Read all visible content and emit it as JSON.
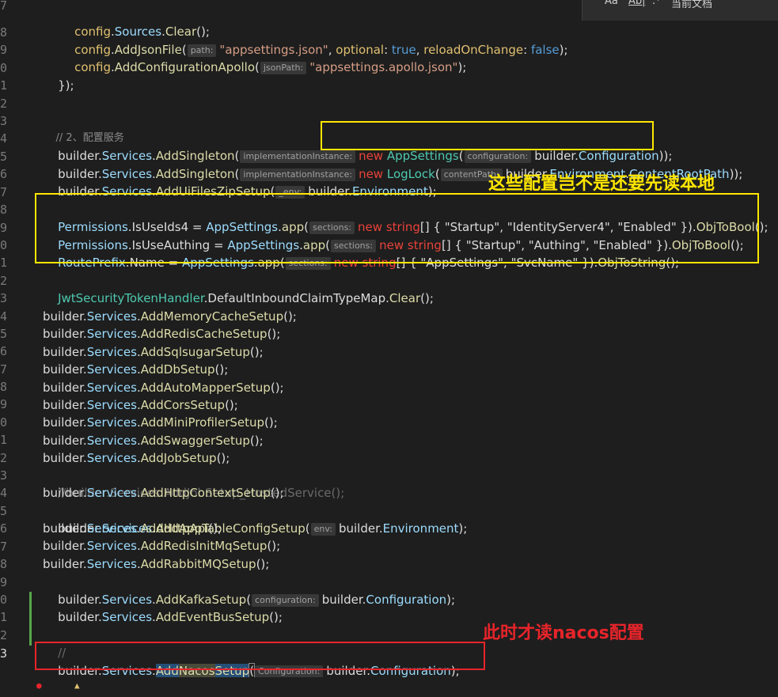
{
  "toolbar": {
    "match_case_label": "Aa",
    "match_word_label": "Ab|",
    "regex_label": ".*",
    "scope_label": "当前文档"
  },
  "line_numbers": [
    "7",
    "8",
    "9",
    "0",
    "1",
    "2",
    "3",
    "4",
    "5",
    "6",
    "7",
    "8",
    "9",
    "0",
    "1",
    "2",
    "3",
    "4",
    "5",
    "6",
    "7",
    "8",
    "9",
    "0",
    "1",
    "2",
    "3",
    "4",
    "5",
    "6",
    "7",
    "8",
    "9",
    "0",
    "1",
    "2",
    "3"
  ],
  "active_line_number": "3",
  "code": {
    "l_sources_clear": {
      "obj": "config",
      "prop": "Sources",
      "method": "Clear",
      "tail": "();"
    },
    "l_add_json": {
      "obj": "config",
      "method": "AddJsonFile",
      "hint": "path:",
      "arg": "\"appsettings.json\"",
      "p2": "optional",
      "v2": "true",
      "p3": "reloadOnChange",
      "v3": "false",
      "tail": ");"
    },
    "l_add_apollo": {
      "obj": "config",
      "method": "AddConfigurationApollo",
      "hint": "jsonPath:",
      "arg": "\"appsettings.apollo.json\"",
      "tail": ");"
    },
    "l_close": "});",
    "l_comment": "// 2、配置服务",
    "l_singleton1": {
      "obj": "builder",
      "svc": "Services",
      "method": "AddSingleton",
      "hint": "implementationInstance:",
      "kw": "new",
      "cls": "AppSettings",
      "hint2": "configuration:",
      "arg": "builder",
      "argprop": "Configuration",
      "tail": "));"
    },
    "l_singleton2": {
      "obj": "builder",
      "svc": "Services",
      "method": "AddSingleton",
      "hint": "implementationInstance:",
      "kw": "new",
      "cls": "LogLock",
      "hint2": "contentPath:",
      "arg": "builder",
      "argprop": "Environment",
      "argprop2": "ContentRootPath",
      "tail": "));"
    },
    "l_uizip": {
      "obj": "builder",
      "svc": "Services",
      "method": "AddUiFilesZipSetup",
      "hint": "_env:",
      "arg": "builder",
      "argprop": "Environment",
      "tail": ");"
    },
    "l_perm1": {
      "cls": "Permissions",
      "prop": "IsUseIds4",
      "eq": " = ",
      "cls2": "AppSettings",
      "method": "app",
      "hint": "sections:",
      "kw": "new",
      "type": "string",
      "brk": "[] { ",
      "s1": "\"Startup\"",
      "s2": "\"IdentityServer4\"",
      "s3": "\"Enabled\"",
      "close": " })",
      "conv": "ObjToBool",
      "tail": "();"
    },
    "l_perm2": {
      "cls": "Permissions",
      "prop": "IsUseAuthing",
      "eq": " = ",
      "cls2": "AppSettings",
      "method": "app",
      "hint": "sections:",
      "kw": "new",
      "type": "string",
      "brk": "[] { ",
      "s1": "\"Startup\"",
      "s2": "\"Authing\"",
      "s3": "\"Enabled\"",
      "close": " })",
      "conv": "ObjToBool",
      "tail": "();"
    },
    "l_route": {
      "cls": "RoutePrefix",
      "prop": "Name",
      "eq": " = ",
      "cls2": "AppSettings",
      "method": "app",
      "hint": "sections:",
      "kw": "new",
      "type": "string",
      "brk": "[] { ",
      "s1": "\"AppSettings\"",
      "s2": "\"SvcName\"",
      "close": " })",
      "conv": "ObjToString",
      "tail": "();"
    },
    "l_jwt": {
      "cls": "JwtSecurityTokenHandler",
      "prop": "DefaultInboundClaimTypeMap",
      "method": "Clear",
      "tail": "();"
    },
    "setup_lines": [
      "AddMemoryCacheSetup",
      "AddRedisCacheSetup",
      "AddSqlsugarSetup",
      "AddDbSetup",
      "AddAutoMapperSetup",
      "AddCorsSetup",
      "AddMiniProfilerSetup",
      "AddSwaggerSetup",
      "AddJobSetup"
    ],
    "l_job_comment": "//builder.Services.AddJobSetup_HostedService();",
    "setup_lines2": [
      "AddHttpContextSetup"
    ],
    "l_apptable": {
      "method": "AddAppTableConfigSetup",
      "hint": "env:",
      "arg": "builder",
      "argprop": "Environment",
      "tail": ");"
    },
    "setup_lines3": [
      "AddHttpApi",
      "AddRedisInitMqSetup",
      "AddRabbitMQSetup"
    ],
    "l_kafka": {
      "method": "AddKafkaSetup",
      "hint": "configuration:",
      "arg": "builder",
      "argprop": "Configuration",
      "tail": ");"
    },
    "l_eventbus": "AddEventBusSetup",
    "l_slash": "//",
    "l_nacos": {
      "obj": "builder",
      "svc": "Services",
      "m1": "Add",
      "m2": "Nacos",
      "m3": "Setup",
      "hint": "Configuration:",
      "arg": "builder",
      "argprop": "Configuration",
      "tail": ");"
    },
    "builder": "builder",
    "services": "Services",
    "call_tail": "();"
  },
  "annotations": {
    "yellow_note": "这些配置岂不是还要先读本地",
    "red_note": "此时才读nacos配置"
  }
}
